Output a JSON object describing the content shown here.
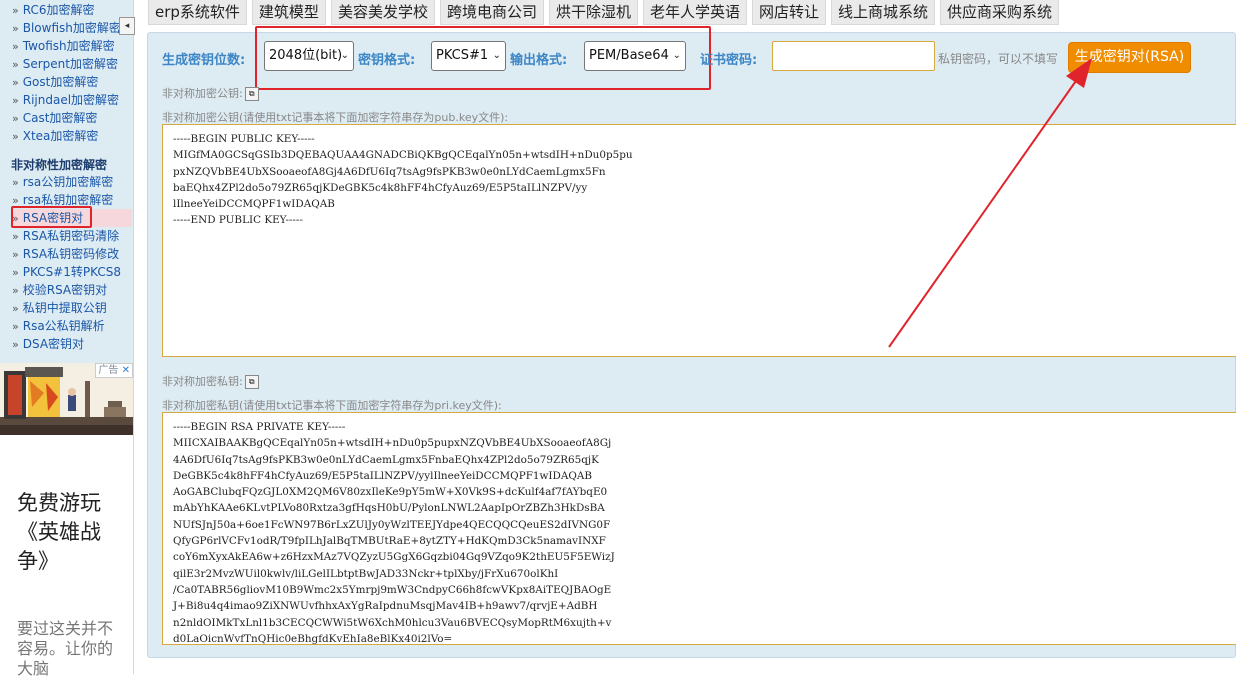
{
  "sidebar": {
    "collapse_icon": "◂",
    "items_top": [
      {
        "label": "RC6加密解密"
      },
      {
        "label": "Blowfish加密解密"
      },
      {
        "label": "Twofish加密解密"
      },
      {
        "label": "Serpent加密解密"
      },
      {
        "label": "Gost加密解密"
      },
      {
        "label": "Rijndael加密解密"
      },
      {
        "label": "Cast加密解密"
      },
      {
        "label": "Xtea加密解密"
      }
    ],
    "section_heading": "非对称性加密解密",
    "items_bottom": [
      {
        "label": "rsa公钥加密解密"
      },
      {
        "label": "rsa私钥加密解密"
      },
      {
        "label": "RSA密钥对"
      },
      {
        "label": "RSA私钥密码清除"
      },
      {
        "label": "RSA私钥密码修改"
      },
      {
        "label": "PKCS#1转PKCS8"
      },
      {
        "label": "校验RSA密钥对"
      },
      {
        "label": "私钥中提取公钥"
      },
      {
        "label": "Rsa公私钥解析"
      },
      {
        "label": "DSA密钥对"
      }
    ],
    "ad": {
      "badge": "广告",
      "close": "✕",
      "title": "免费游玩《英雄战争》",
      "subtitle": "要过这关并不容易。让你的大脑"
    }
  },
  "topnav": {
    "tabs": [
      "erp系统软件",
      "建筑模型",
      "美容美发学校",
      "跨境电商公司",
      "烘干除湿机",
      "老年人学英语",
      "网店转让",
      "线上商城系统",
      "供应商采购系统"
    ]
  },
  "form": {
    "bits_label": "生成密钥位数:",
    "bits_value": "2048位(bit)",
    "format_label": "密钥格式:",
    "format_value": "PKCS#1",
    "output_label": "输出格式:",
    "output_value": "PEM/Base64",
    "cert_label": "证书密码:",
    "cert_value": "",
    "cert_hint": "私钥密码，可以不填写",
    "generate_button": "生成密钥对(RSA)"
  },
  "public_key": {
    "copy_label": "非对称加密公钥:",
    "desc": "非对称加密公钥(请使用txt记事本将下面加密字符串存为pub.key文件):",
    "text": "-----BEGIN PUBLIC KEY-----\nMIGfMA0GCSqGSIb3DQEBAQUAA4GNADCBiQKBgQCEqalYn05n+wtsdIH+nDu0p5pu\npxNZQVbBE4UbXSooaeofA8Gj4A6DfU6Iq7tsAg9fsPKB3w0e0nLYdCaemLgmx5Fn\nbaEQhx4ZPl2do5o79ZR65qjKDeGBK5c4k8hFF4hCfyAuz69/E5P5taILlNZPV/yy\nlIlneeYeiDCCMQPF1wIDAQAB\n-----END PUBLIC KEY-----"
  },
  "private_key": {
    "copy_label": "非对称加密私钥:",
    "desc": "非对称加密私钥(请使用txt记事本将下面加密字符串存为pri.key文件):",
    "text": "-----BEGIN RSA PRIVATE KEY-----\nMIICXAIBAAKBgQCEqalYn05n+wtsdIH+nDu0p5pupxNZQVbBE4UbXSooaeofA8Gj\n4A6DfU6Iq7tsAg9fsPKB3w0e0nLYdCaemLgmx5FnbaEQhx4ZPl2do5o79ZR65qjK\nDeGBK5c4k8hFF4hCfyAuz69/E5P5taILlNZPV/yylIlneeYeiDCCMQPF1wIDAQAB\nAoGABClubqFQzGJL0XM2QM6V80zxIleKe9pY5mW+X0Vk9S+dcKulf4af7fAYbqE0\nmAbYhKAAe6KLvtPLVo80Rxtza3gfHqsH0bU/PylonLNWL2AapIpOrZBZh3HkDsBA\nNUfSJnJ50a+6oe1FcWN97B6rLxZUlJy0yWzlTEEJYdpe4QECQQCQeuES2dIVNG0F\nQfyGP6rlVCFv1odR/T9fpILhJalBqTMBUtRaE+8ytZTY+HdKQmD3Ck5namavINXF\ncoY6mXyxAkEA6w+z6HzxMAz7VQZyzU5GgX6Gqzbi04Gq9VZqo9K2thEU5F5EWizJ\nqilE3r2MvzWUil0kwlv/liLGelILbtptBwJAD33Nckr+tplXby/jFrXu670olKhI\n/Ca0TABR56gliovM10B9Wmc2x5Ymrpj9mW3CndpyC66h8fcwVKpx8AiTEQJBAOgE\nJ+Bi8u4q4imao9ZiXNWUvfhhxAxYgRaIpdnuMsqjMav4IB+h9awv7/qrvjE+AdBH\nn2nldOIMkTxLnl1b3CECQCWWi5tW6XchM0hlcu3Vau6BVECQsyMopRtM6xujth+v\nd0LaOicnWvfTnQHic0eBhgfdKvEhIa8eBlKx40i2lVo=\n-----END RSA PRIVATE KEY-----"
  },
  "colors": {
    "accent": "#f08c00",
    "label_blue": "#3d86c6",
    "panel_bg": "#ddebf3",
    "annotation_red": "#e0242c"
  }
}
